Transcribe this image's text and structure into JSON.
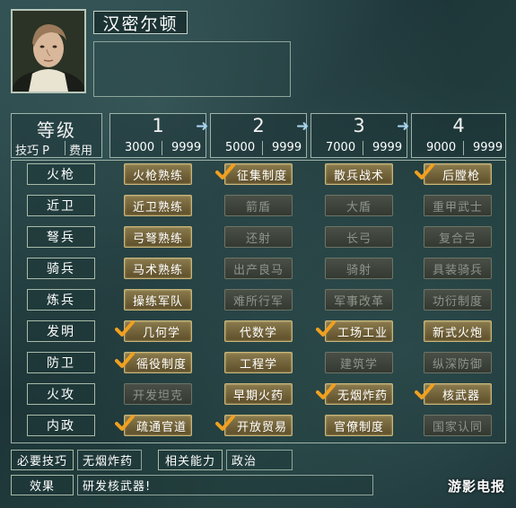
{
  "character": {
    "name": "汉密尔顿"
  },
  "header": {
    "grade_label": "等级",
    "skill_p_label": "技巧 P",
    "cost_label": "费用",
    "levels": [
      {
        "number": "1",
        "p": "3000",
        "cost": "9999"
      },
      {
        "number": "2",
        "p": "5000",
        "cost": "9999"
      },
      {
        "number": "3",
        "p": "7000",
        "cost": "9999"
      },
      {
        "number": "4",
        "p": "9000",
        "cost": "9999"
      }
    ]
  },
  "rows": [
    {
      "label": "火枪",
      "skills": [
        {
          "name": "火枪熟练",
          "state": "available",
          "learned": false
        },
        {
          "name": "征集制度",
          "state": "available",
          "learned": true
        },
        {
          "name": "散兵战术",
          "state": "available",
          "learned": false
        },
        {
          "name": "后膛枪",
          "state": "available",
          "learned": true
        }
      ]
    },
    {
      "label": "近卫",
      "skills": [
        {
          "name": "近卫熟练",
          "state": "available",
          "learned": false
        },
        {
          "name": "箭盾",
          "state": "locked",
          "learned": false
        },
        {
          "name": "大盾",
          "state": "locked",
          "learned": false
        },
        {
          "name": "重甲武士",
          "state": "locked",
          "learned": false
        }
      ]
    },
    {
      "label": "弩兵",
      "skills": [
        {
          "name": "弓弩熟练",
          "state": "available",
          "learned": false
        },
        {
          "name": "还射",
          "state": "locked",
          "learned": false
        },
        {
          "name": "长弓",
          "state": "locked",
          "learned": false
        },
        {
          "name": "复合弓",
          "state": "locked",
          "learned": false
        }
      ]
    },
    {
      "label": "骑兵",
      "skills": [
        {
          "name": "马术熟练",
          "state": "available",
          "learned": false
        },
        {
          "name": "出产良马",
          "state": "locked",
          "learned": false
        },
        {
          "name": "骑射",
          "state": "locked",
          "learned": false
        },
        {
          "name": "具装骑兵",
          "state": "locked",
          "learned": false
        }
      ]
    },
    {
      "label": "炼兵",
      "skills": [
        {
          "name": "操练军队",
          "state": "available",
          "learned": false
        },
        {
          "name": "难所行军",
          "state": "locked",
          "learned": false
        },
        {
          "name": "军事改革",
          "state": "locked",
          "learned": false
        },
        {
          "name": "功衍制度",
          "state": "locked",
          "learned": false
        }
      ]
    },
    {
      "label": "发明",
      "skills": [
        {
          "name": "几何学",
          "state": "available",
          "learned": true
        },
        {
          "name": "代数学",
          "state": "available",
          "learned": false
        },
        {
          "name": "工场工业",
          "state": "available",
          "learned": true
        },
        {
          "name": "新式火炮",
          "state": "available",
          "learned": false
        }
      ]
    },
    {
      "label": "防卫",
      "skills": [
        {
          "name": "徭役制度",
          "state": "available",
          "learned": true
        },
        {
          "name": "工程学",
          "state": "available",
          "learned": false
        },
        {
          "name": "建筑学",
          "state": "locked",
          "learned": false
        },
        {
          "name": "纵深防御",
          "state": "locked",
          "learned": false
        }
      ]
    },
    {
      "label": "火攻",
      "skills": [
        {
          "name": "开发坦克",
          "state": "locked",
          "learned": false
        },
        {
          "name": "早期火药",
          "state": "available",
          "learned": false
        },
        {
          "name": "无烟炸药",
          "state": "available",
          "learned": true
        },
        {
          "name": "核武器",
          "state": "available",
          "learned": true
        }
      ]
    },
    {
      "label": "内政",
      "skills": [
        {
          "name": "疏通官道",
          "state": "available",
          "learned": true
        },
        {
          "name": "开放贸易",
          "state": "available",
          "learned": true
        },
        {
          "name": "官僚制度",
          "state": "available",
          "learned": false
        },
        {
          "name": "国家认同",
          "state": "locked",
          "learned": false
        }
      ]
    }
  ],
  "footer": {
    "required_label": "必要技巧",
    "required_value": "无烟炸药",
    "related_label": "相关能力",
    "related_value": "政治",
    "effect_label": "效果",
    "effect_value": "研发核武器!"
  },
  "watermark": "游影电报",
  "colors": {
    "accent_gold": "#c9b778",
    "check_orange": "#f0a020",
    "arrow_blue": "#a8d4ef"
  }
}
